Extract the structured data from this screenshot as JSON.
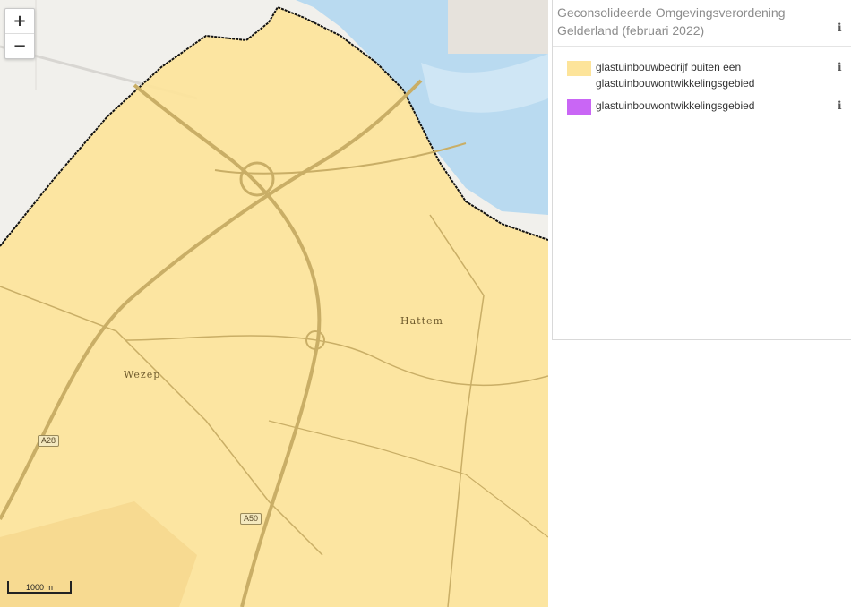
{
  "legend": {
    "title": "Geconsolideerde Omgevingsverordening Gelderland (februari 2022)",
    "items": [
      {
        "label": "glastuinbouwbedrijf buiten een glastuinbouwontwikkelingsgebied",
        "color": "#fde49a"
      },
      {
        "label": "glastuinbouwontwikkelingsgebied",
        "color": "#c966f5"
      }
    ],
    "info_glyph": "i"
  },
  "map": {
    "zoom_in": "+",
    "zoom_out": "−",
    "scale_label": "1000 m",
    "places": [
      "Hattem",
      "Wezep"
    ],
    "roads": [
      "A28",
      "A50"
    ],
    "colors": {
      "base": "#f1f0ec",
      "water": "#b9daf0",
      "overlay": "#fde49a",
      "boundary": "#111111"
    }
  }
}
